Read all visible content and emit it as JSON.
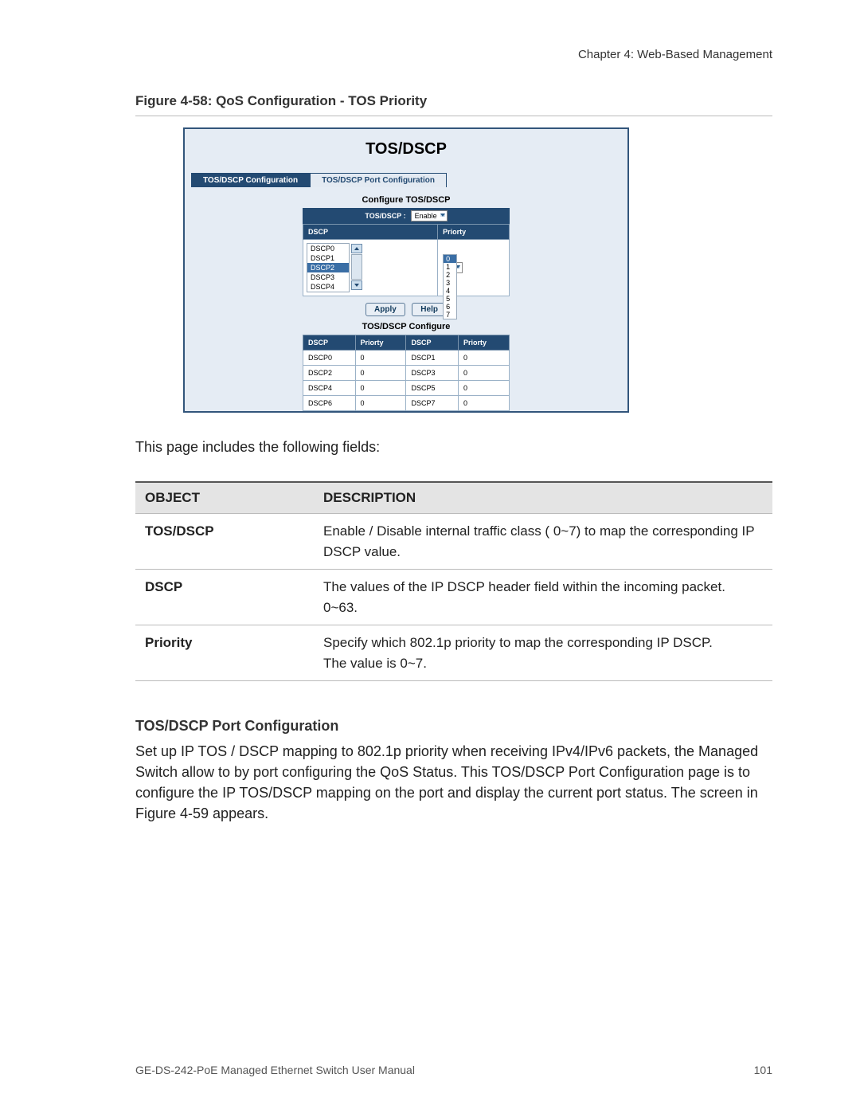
{
  "chapter": "Chapter 4: Web-Based Management",
  "figure_caption": "Figure 4-58: QoS Configuration - TOS Priority",
  "shot": {
    "title": "TOS/DSCP",
    "tab_active": "TOS/DSCP Configuration",
    "tab_idle": "TOS/DSCP Port Configuration",
    "conf_title": "Configure TOS/DSCP",
    "tosdscp_label": "TOS/DSCP :",
    "tosdscp_value": "Enable",
    "col_dscp": "DSCP",
    "col_priority": "Priorty",
    "listbox": [
      "DSCP0",
      "DSCP1",
      "DSCP2",
      "DSCP3",
      "DSCP4"
    ],
    "listbox_selected_index": 2,
    "priority_current": "0",
    "priority_options": [
      "0",
      "1",
      "2",
      "3",
      "4",
      "5",
      "6",
      "7"
    ],
    "btn_apply": "Apply",
    "btn_help": "Help",
    "configure_table_title": "TOS/DSCP Configure",
    "rows": [
      {
        "d1": "DSCP0",
        "p1": "0",
        "d2": "DSCP1",
        "p2": "0"
      },
      {
        "d1": "DSCP2",
        "p1": "0",
        "d2": "DSCP3",
        "p2": "0"
      },
      {
        "d1": "DSCP4",
        "p1": "0",
        "d2": "DSCP5",
        "p2": "0"
      },
      {
        "d1": "DSCP6",
        "p1": "0",
        "d2": "DSCP7",
        "p2": "0"
      }
    ]
  },
  "intro_para": "This page includes the following fields:",
  "doc_table": {
    "hdr_obj": "OBJECT",
    "hdr_desc": "DESCRIPTION",
    "r1o": "TOS/DSCP",
    "r1d": "Enable / Disable internal traffic class ( 0~7) to map the corresponding IP DSCP value.",
    "r2o": "DSCP",
    "r2d": "The values of the IP DSCP header field within the incoming packet.\n0~63.",
    "r3o": "Priority",
    "r3d": "Specify which 802.1p priority to map the corresponding IP DSCP.\nThe value is 0~7."
  },
  "section_head": "TOS/DSCP Port Configuration",
  "section_para": "Set up IP TOS / DSCP mapping to 802.1p priority when receiving IPv4/IPv6 packets, the Managed Switch allow to by port configuring the QoS Status. This TOS/DSCP Port Configuration page is to configure the IP TOS/DSCP mapping on the port and display the current port status. The screen in Figure 4-59 appears.",
  "footer_left": "GE-DS-242-PoE Managed Ethernet Switch User Manual",
  "footer_right": "101"
}
